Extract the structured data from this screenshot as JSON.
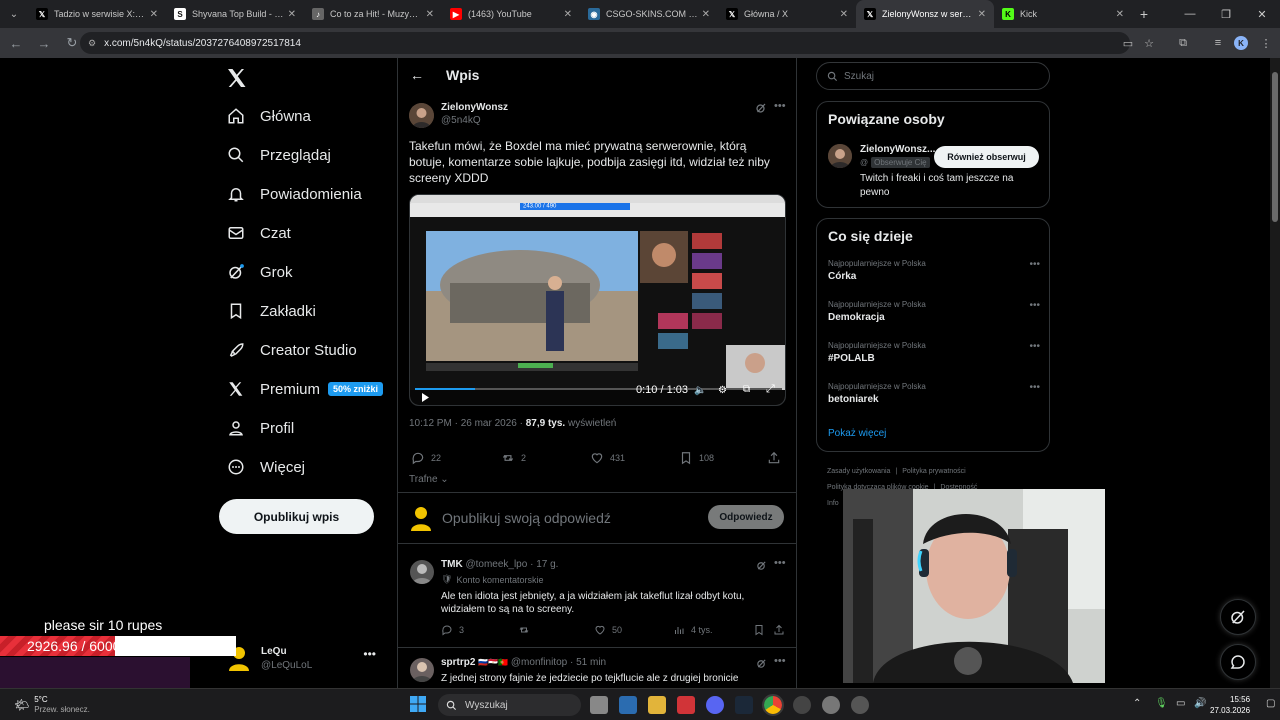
{
  "browser": {
    "tabs": [
      {
        "title": "Tadzio w serwisie X: „dost",
        "favicon": "x-icon",
        "active": false
      },
      {
        "title": "Shyvana Top Build - Rune",
        "favicon": "shyvana-icon",
        "active": false
      },
      {
        "title": "Co to za Hit! - Muzyczny",
        "favicon": "music-icon",
        "active": false
      },
      {
        "title": "(1463) YouTube",
        "favicon": "youtube-icon",
        "active": false
      },
      {
        "title": "CSGO-SKINS.COM - Najle",
        "favicon": "csgo-icon",
        "active": false
      },
      {
        "title": "Główna / X",
        "favicon": "x-icon",
        "active": false
      },
      {
        "title": "ZielonyWonsz w serwisie",
        "favicon": "x-icon",
        "active": true
      },
      {
        "title": "Kick",
        "favicon": "kick-icon",
        "active": false
      }
    ],
    "url": "x.com/5n4kQ/status/2037276408972517814",
    "profile_initial": "K"
  },
  "nav": {
    "items": [
      {
        "label": "Główna",
        "icon": "home-icon"
      },
      {
        "label": "Przeglądaj",
        "icon": "search-icon"
      },
      {
        "label": "Powiadomienia",
        "icon": "bell-icon"
      },
      {
        "label": "Czat",
        "icon": "mail-icon"
      },
      {
        "label": "Grok",
        "icon": "grok-icon"
      },
      {
        "label": "Zakładki",
        "icon": "bookmark-icon"
      },
      {
        "label": "Creator Studio",
        "icon": "rocket-icon"
      },
      {
        "label": "Premium",
        "icon": "x-icon",
        "badge": "50% zniżki"
      },
      {
        "label": "Profil",
        "icon": "person-icon"
      },
      {
        "label": "Więcej",
        "icon": "more-circle-icon"
      }
    ],
    "post_button": "Opublikuj wpis",
    "profile": {
      "name": "LeQu",
      "handle": "@LeQuLoL"
    }
  },
  "main": {
    "header_title": "Wpis",
    "tweet": {
      "name": "ZielonyWonsz",
      "handle": "@5n4kQ",
      "text": "Takefun mówi, że Boxdel ma mieć prywatną serwerownie, którą botuje, komentarze sobie lajkuje, podbija zasięgi itd, widział też niby screeny XDDD",
      "video_time": "0:10 / 1:03",
      "video_inner_counter": "243.00 / 490",
      "timestamp": "10:12 PM · 26 mar 2026 · ",
      "views_count": "87,9 tys.",
      "views_label": " wyświetleń",
      "stats": {
        "replies": "22",
        "reposts": "2",
        "likes": "431",
        "bookmarks": "108"
      }
    },
    "sort_label": "Trafne",
    "reply_placeholder": "Opublikuj swoją odpowiedź",
    "reply_button": "Odpowiedz",
    "replies": [
      {
        "name": "TMK",
        "handle": "@tomeek_lpo · 17 g.",
        "tag": "Konto komentatorskie",
        "text": "Ale ten idiota jest jebnięty, a ja widziałem jak takeflut lizał odbyt kotu, widziałem to są na to screeny.",
        "stats": {
          "replies": "3",
          "reposts": "",
          "likes": "50",
          "views": "4 tys."
        }
      },
      {
        "name": "sprtrp2",
        "handle": "@monfinitop · 51 min",
        "text": "Z jednej strony fajnie że jedziecie po tejkflucie ale z drugiej bronicie"
      }
    ]
  },
  "right": {
    "search_placeholder": "Szukaj",
    "related": {
      "title": "Powiązane osoby",
      "name": "ZielonyWonsz...",
      "handle_prefix": "@",
      "follows_you": "Obserwuje Cię",
      "follow_button": "Również obserwuj",
      "bio": "Twitch i freaki i coś tam jeszcze na pewno"
    },
    "trending": {
      "title": "Co się dzieje",
      "items": [
        {
          "context": "Najpopularniejsze w Polska",
          "name": "Córka"
        },
        {
          "context": "Najpopularniejsze w Polska",
          "name": "Demokracja"
        },
        {
          "context": "Najpopularniejsze w Polska",
          "name": "#POLALB"
        },
        {
          "context": "Najpopularniejsze w Polska",
          "name": "betoniarek"
        }
      ],
      "show_more": "Pokaż więcej"
    },
    "footer": [
      "Zasady użytkowania",
      "|",
      "Polityka prywatności",
      "|",
      "Polityka dotycząca plików cookie",
      "|",
      "Dostępność",
      "|",
      "Info"
    ]
  },
  "overlay": {
    "donation_text": "please sir 10 rupes",
    "donation_value": "2926.96 / 6000 (48.78%)",
    "donation_fraction": 0.4878
  },
  "taskbar": {
    "weather_temp": "5°C",
    "weather_desc": "Przew. słonecz.",
    "search_label": "Wyszukaj",
    "time": "15:56",
    "date": "27.03.2026"
  },
  "colors": {
    "accent": "#1d9bf0",
    "background": "#000000",
    "text": "#e7e9ea",
    "muted": "#71767b",
    "donation_fill": "#e8303a"
  }
}
